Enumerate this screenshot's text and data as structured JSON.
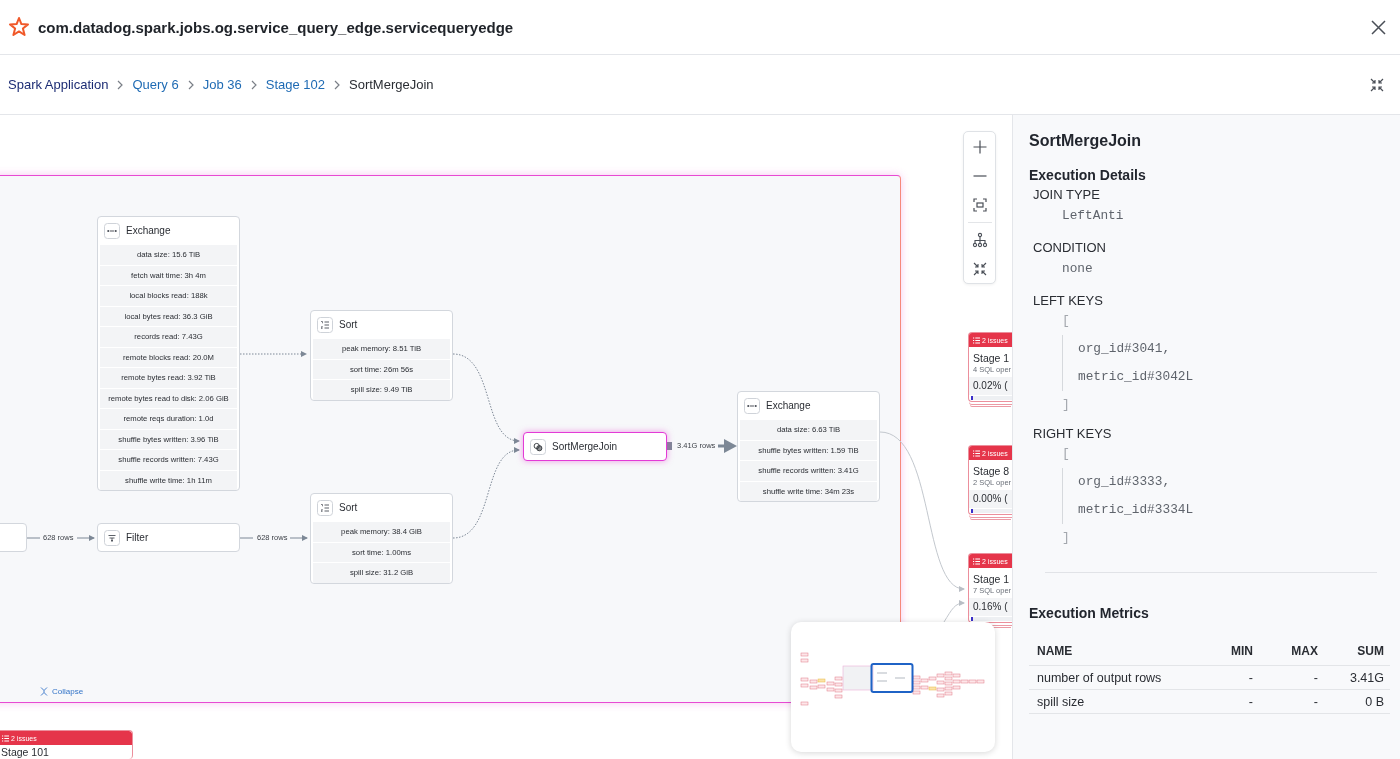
{
  "header": {
    "title": "com.datadog.spark.jobs.og.service_query_edge.servicequeryedge"
  },
  "breadcrumbs": [
    {
      "label": "Spark Application",
      "kind": "root"
    },
    {
      "label": "Query 6",
      "kind": "link"
    },
    {
      "label": "Job 36",
      "kind": "link"
    },
    {
      "label": "Stage 102",
      "kind": "link"
    },
    {
      "label": "SortMergeJoin",
      "kind": "current"
    }
  ],
  "canvas": {
    "stage_group": {
      "collapse_label": "Collapse"
    },
    "nodes": [
      {
        "kind": "exchange",
        "title": "Exchange",
        "selected": false,
        "metrics": [
          "data size: 15.6 TiB",
          "fetch wait time: 3h 4m",
          "local blocks read: 188k",
          "local bytes read: 36.3 GiB",
          "records read: 7.43G",
          "remote blocks read: 20.0M",
          "remote bytes read: 3.92 TiB",
          "remote bytes read to disk: 2.06 GiB",
          "remote reqs duration: 1.0d",
          "shuffle bytes written: 3.96 TiB",
          "shuffle records written: 7.43G",
          "shuffle write time: 1h 11m"
        ]
      },
      {
        "kind": "sort",
        "title": "Sort",
        "selected": false,
        "metrics": [
          "peak memory: 8.51 TiB",
          "sort time: 26m 56s",
          "spill size: 9.49 TiB"
        ]
      },
      {
        "kind": "filter",
        "title": "Filter",
        "selected": false
      },
      {
        "kind": "sort",
        "title": "Sort",
        "selected": false,
        "metrics": [
          "peak memory: 38.4 GiB",
          "sort time: 1.00ms",
          "spill size: 31.2 GiB"
        ]
      },
      {
        "kind": "join",
        "title": "SortMergeJoin",
        "selected": true
      },
      {
        "kind": "exchange",
        "title": "Exchange",
        "selected": false,
        "metrics": [
          "data size: 6.63 TiB",
          "shuffle bytes written: 1.59 TiB",
          "shuffle records written: 3.41G",
          "shuffle write time: 34m 23s"
        ]
      }
    ],
    "edge_labels": [
      "628 rows",
      "628 rows",
      "3.41G rows"
    ],
    "stage_cards": [
      {
        "issues": "2 issues",
        "title": "Stage 1",
        "subtitle": "4 SQL oper",
        "progress": "0.02% (",
        "level": 0.0002
      },
      {
        "issues": "2 issues",
        "title": "Stage 8",
        "subtitle": "2 SQL oper",
        "progress": "0.00% (",
        "level": 4e-05
      },
      {
        "issues": "2 issues",
        "title": "Stage 1",
        "subtitle": "7 SQL oper",
        "progress": "0.16% (",
        "level": 0.0016
      },
      {
        "issues": "2 issues",
        "title": "Stage 101"
      }
    ]
  },
  "details_panel": {
    "title": "SortMergeJoin",
    "details_heading": "Execution Details",
    "fields": [
      {
        "kind": "value",
        "label": "JOIN TYPE",
        "value": "LeftAnti"
      },
      {
        "kind": "value",
        "label": "CONDITION",
        "value": "none"
      },
      {
        "kind": "list",
        "label": "LEFT KEYS",
        "open": "[",
        "items": [
          "org_id#3041,",
          "metric_id#3042L"
        ],
        "close": "]"
      },
      {
        "kind": "list",
        "label": "RIGHT KEYS",
        "open": "[",
        "items": [
          "org_id#3333,",
          "metric_id#3334L"
        ],
        "close": "]"
      }
    ],
    "metrics_heading": "Execution Metrics",
    "table": {
      "columns": [
        "NAME",
        "MIN",
        "MAX",
        "SUM"
      ],
      "rows": [
        [
          "number of output rows",
          "-",
          "-",
          "3.41G"
        ],
        [
          "spill size",
          "-",
          "-",
          "0 B"
        ]
      ]
    }
  }
}
